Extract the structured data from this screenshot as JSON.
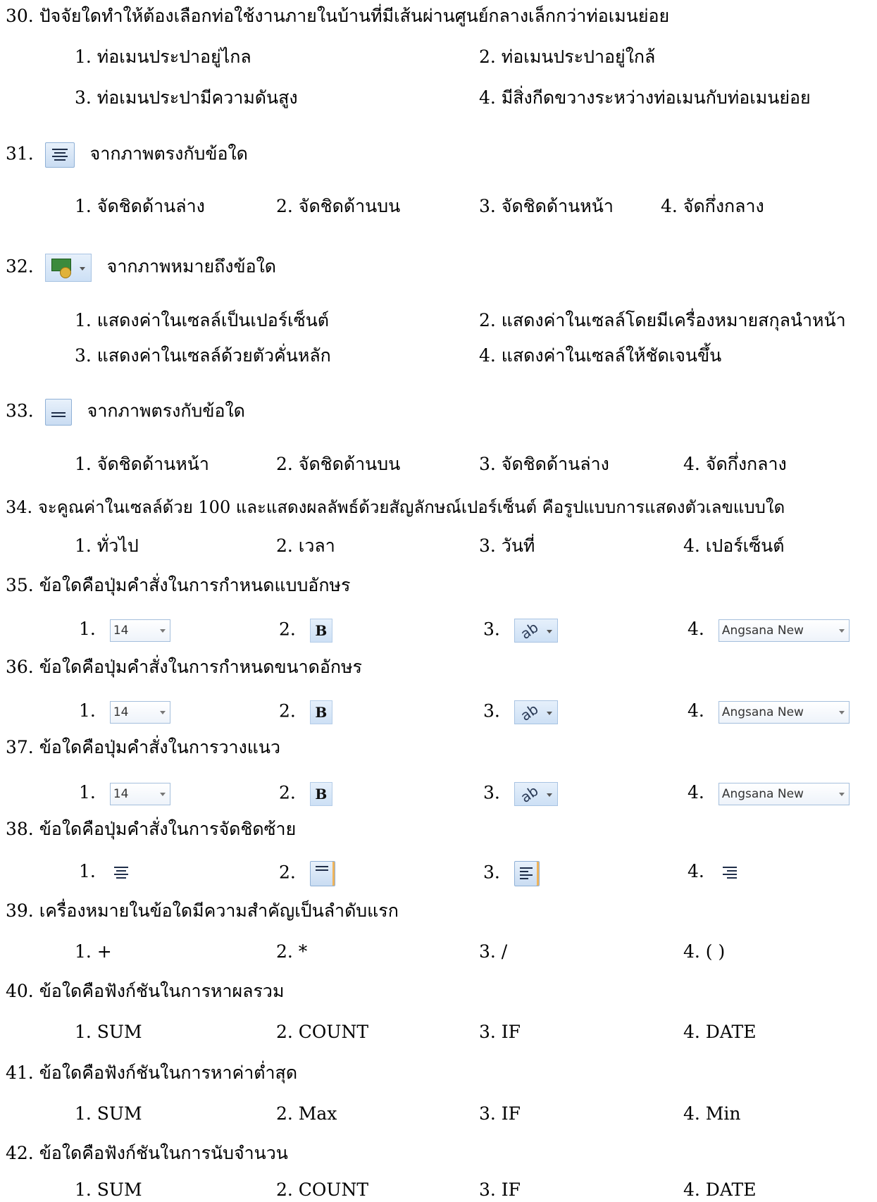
{
  "questions": [
    {
      "num": "30.",
      "text": "ปัจจัยใดทำให้ต้องเลือกท่อใช้งานภายในบ้านที่มีเส้นผ่านศูนย์กลางเล็กกว่าท่อเมนย่อย",
      "choices": [
        "1. ท่อเมนประปาอยู่ไกล",
        "2. ท่อเมนประปาอยู่ใกล้",
        "3. ท่อเมนประปามีความดันสูง",
        "4. มีสิ่งกีดขวางระหว่างท่อเมนกับท่อเมนย่อย"
      ]
    },
    {
      "num": "31.",
      "text": "จากภาพตรงกับข้อใด",
      "icon": "align-center-icon",
      "choices": [
        "1. จัดชิดด้านล่าง",
        "2. จัดชิดด้านบน",
        "3. จัดชิดด้านหน้า",
        "4. จัดกึ่งกลาง"
      ]
    },
    {
      "num": "32.",
      "text": "จากภาพหมายถึงข้อใด",
      "icon": "currency-format-icon",
      "choices": [
        "1. แสดงค่าในเซลล์เป็นเปอร์เซ็นต์",
        "2. แสดงค่าในเซลล์โดยมีเครื่องหมายสกุลนำหน้า",
        "3. แสดงค่าในเซลล์ด้วยตัวคั่นหลัก",
        "4.  แสดงค่าในเซลล์ให้ชัดเจนขึ้น"
      ]
    },
    {
      "num": "33.",
      "text": "จากภาพตรงกับข้อใด",
      "icon": "align-bottom-icon",
      "choices": [
        "1. จัดชิดด้านหน้า",
        "2. จัดชิดด้านบน",
        "3. จัดชิดด้านล่าง",
        "4. จัดกึ่งกลาง"
      ]
    },
    {
      "num": "34.",
      "text": "จะคูณค่าในเซลล์ด้วย 100 และแสดงผลลัพธ์ด้วยสัญลักษณ์เปอร์เซ็นต์  คือรูปแบบการแสดงตัวเลขแบบใด",
      "choices": [
        "1. ทั่วไป",
        "2. เวลา",
        "3. วันที่",
        "4. เปอร์เซ็นต์"
      ]
    },
    {
      "num": "35.",
      "text": "ข้อใดคือปุ่มคำสั่งในการกำหนดแบบอักษร",
      "choices": [
        "1.",
        "2.",
        "3.",
        "4."
      ]
    },
    {
      "num": "36.",
      "text": "ข้อใดคือปุ่มคำสั่งในการกำหนดขนาดอักษร",
      "choices": [
        "1.",
        "2.",
        "3.",
        "4."
      ]
    },
    {
      "num": "37.",
      "text": "ข้อใดคือปุ่มคำสั่งในการวางแนว",
      "choices": [
        "1.",
        "2.",
        "3.",
        "4."
      ]
    },
    {
      "num": "38.",
      "text": "ข้อใดคือปุ่มคำสั่งในการจัดชิดซ้าย",
      "choices": [
        "1.",
        "2.",
        "3.",
        "4."
      ]
    },
    {
      "num": "39.",
      "text": "เครื่องหมายในข้อใดมีความสำคัญเป็นลำดับแรก",
      "choices": [
        "1. +",
        "2. *",
        "3. /",
        "4. ( )"
      ]
    },
    {
      "num": "40.",
      "text": "ข้อใดคือฟังก์ชันในการหาผลรวม",
      "choices": [
        "1. SUM",
        "2. COUNT",
        "3. IF",
        "4. DATE"
      ]
    },
    {
      "num": "41.",
      "text": "ข้อใดคือฟังก์ชันในการหาค่าต่ำสุด",
      "choices": [
        "1. SUM",
        "2. Max",
        "3. IF",
        "4. Min"
      ]
    },
    {
      "num": "42.",
      "text": "ข้อใดคือฟังก์ชันในการนับจำนวน",
      "choices": [
        "1. SUM",
        "2. COUNT",
        "3. IF",
        "4. DATE"
      ]
    }
  ],
  "toolbar": {
    "font_size_value": "14",
    "bold_label": "B",
    "font_name_value": "Angsana New"
  }
}
